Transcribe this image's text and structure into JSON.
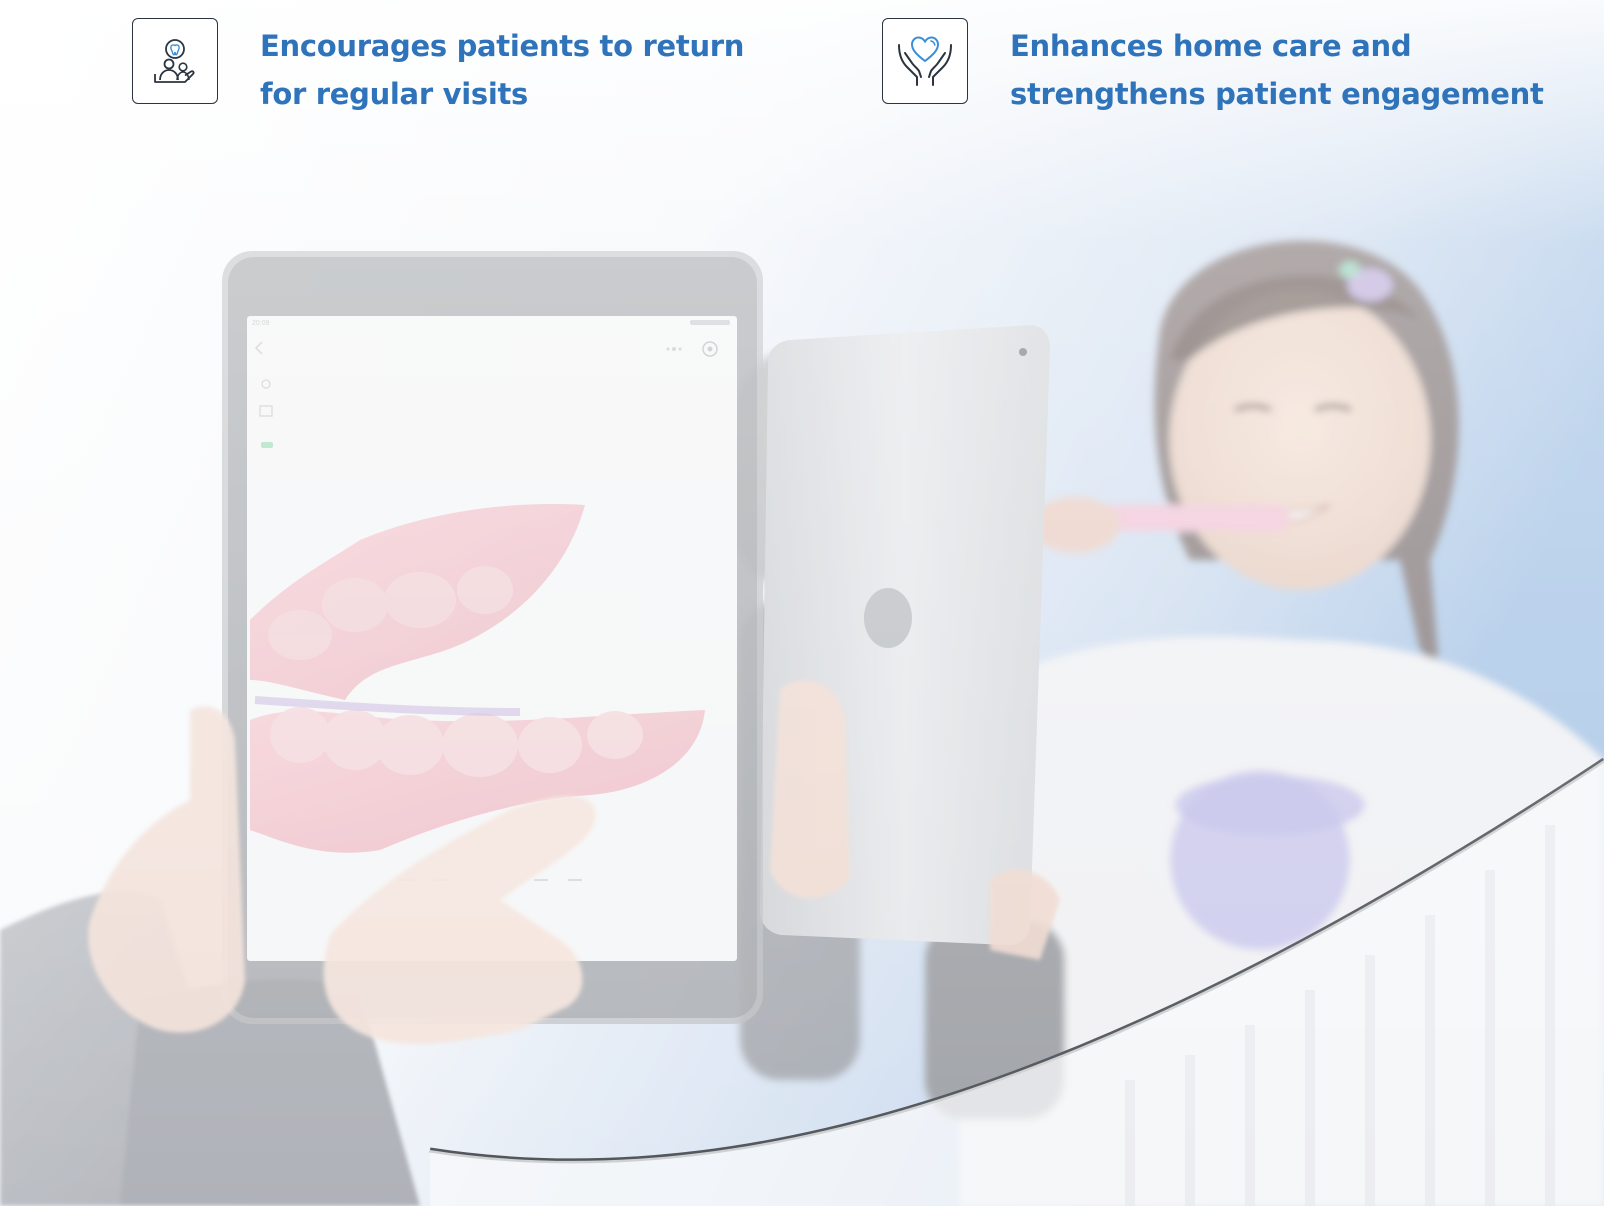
{
  "features": [
    {
      "icon": "dentist-patient-icon",
      "line1": "Encourages patients to return",
      "line2": "for regular visits"
    },
    {
      "icon": "heart-hands-icon",
      "line1": "Enhances home care and",
      "line2": "strengthens patient engagement"
    }
  ],
  "colors": {
    "heading": "#2f74bb",
    "icon_accent": "#3b8fd9",
    "icon_stroke": "#2b3440"
  }
}
